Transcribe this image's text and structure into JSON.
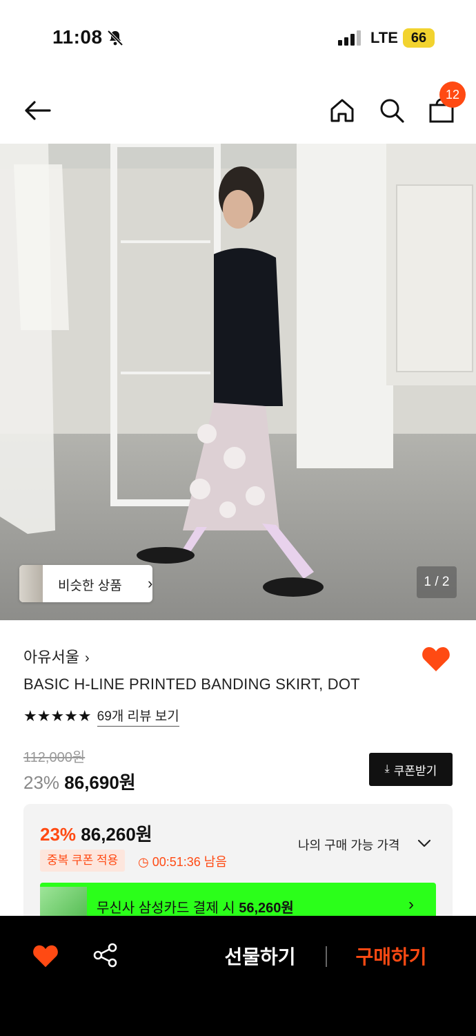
{
  "status_bar": {
    "time": "11:08",
    "network": "LTE",
    "battery": "66"
  },
  "nav": {
    "cart_count": "12"
  },
  "gallery": {
    "similar_label": "비슷한 상품",
    "page_indicator": "1 / 2"
  },
  "product": {
    "brand": "아유서울",
    "name": "BASIC H-LINE PRINTED BANDING SKIRT, DOT",
    "stars": "★★★★★",
    "rating": 5,
    "reviews_label": "69개 리뷰 보기",
    "original_price": "112,000원",
    "discount": "23%",
    "price": "86,690원",
    "coupon_label": "쿠폰받기"
  },
  "price_box": {
    "best_discount": "23%",
    "best_price": "86,260원",
    "coupon_tag": "중복 쿠폰 적용",
    "timer": "00:51:36 남음",
    "my_price_label": "나의 구매 가능 가격",
    "card_text_prefix": "무신사 삼성카드 결제 시",
    "card_price": "56,260원"
  },
  "bottom": {
    "gift_label": "선물하기",
    "buy_label": "구매하기"
  },
  "colors": {
    "accent": "#ff4a13",
    "card_banner": "#2bff1a",
    "battery": "#f2d32f"
  }
}
